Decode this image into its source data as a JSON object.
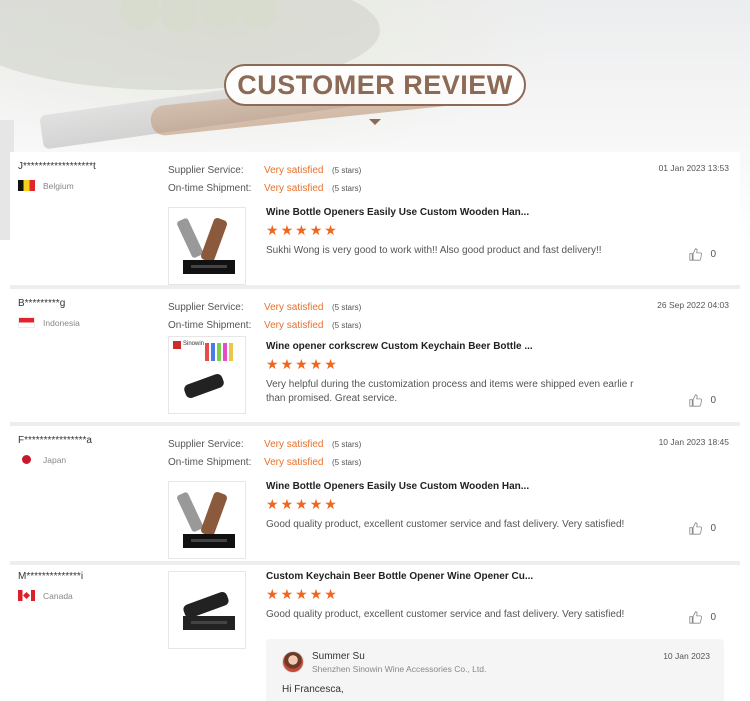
{
  "header": {
    "title": "CUSTOMER REVIEW"
  },
  "labels": {
    "supplier_service": "Supplier Service:",
    "ontime_shipment": "On-time Shipment:"
  },
  "reviews": [
    {
      "user": "J******************t",
      "country": "Belgium",
      "date": "01 Jan 2023 13:53",
      "supplier_value": "Very satisfied",
      "supplier_stars": "(5 stars)",
      "shipment_value": "Very satisfied",
      "shipment_stars": "(5 stars)",
      "product_title": "Wine Bottle Openers Easily Use Custom Wooden Han...",
      "rating": 5,
      "comment": "Sukhi Wong is very good to work with!! Also good product and fast delivery!!",
      "likes": "0"
    },
    {
      "user": "B*********g",
      "country": "Indonesia",
      "date": "26 Sep 2022 04:03",
      "supplier_value": "Very satisfied",
      "supplier_stars": "(5 stars)",
      "shipment_value": "Very satisfied",
      "shipment_stars": "(5 stars)",
      "product_title": "Wine opener corkscrew Custom Keychain Beer Bottle ...",
      "rating": 5,
      "comment": "Very helpful during the customization process and items were shipped even earlie r than promised. Great service.",
      "likes": "0",
      "image_brand": "Sinowin"
    },
    {
      "user": "F****************a",
      "country": "Japan",
      "date": "10 Jan 2023 18:45",
      "supplier_value": "Very satisfied",
      "supplier_stars": "(5 stars)",
      "shipment_value": "Very satisfied",
      "shipment_stars": "(5 stars)",
      "product_title": "Wine Bottle Openers Easily Use Custom Wooden Han...",
      "rating": 5,
      "comment": "Good quality product, excellent customer service and fast delivery. Very satisfied!",
      "likes": "0"
    },
    {
      "user": "M**************i",
      "country": "Canada",
      "product_title": "Custom Keychain Beer Bottle Opener Wine Opener Cu...",
      "rating": 5,
      "comment": "Good quality product, excellent customer service and fast delivery. Very satisfied!",
      "likes": "0",
      "reply": {
        "name": "Summer Su",
        "company": "Shenzhen Sinowin Wine Accessories Co., Ltd.",
        "date": "10 Jan 2023",
        "text": "Hi Francesca,"
      }
    }
  ],
  "icons": {
    "like": "thumbs-up-icon",
    "star": "star-icon"
  },
  "colors": {
    "accent": "#e8712d",
    "star": "#f0661f",
    "title": "#8c6a55"
  }
}
